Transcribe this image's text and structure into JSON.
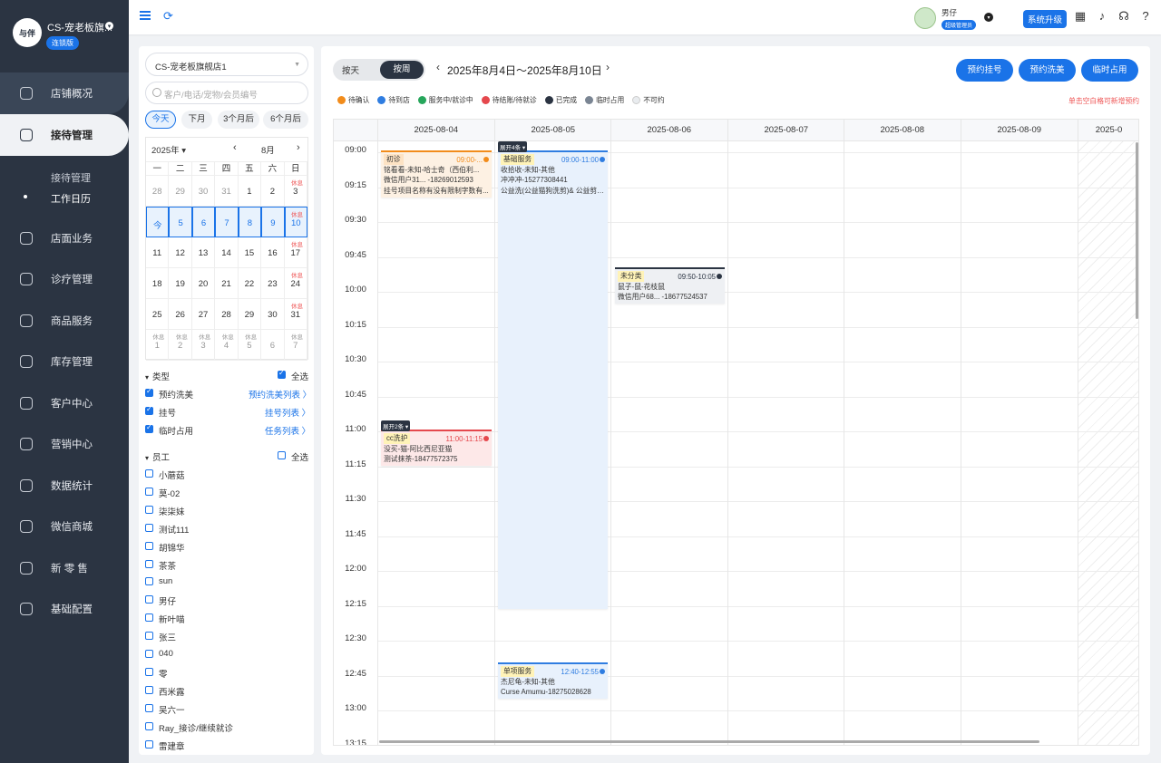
{
  "sidebar": {
    "logo_text": "与伴",
    "store_name": "CS-宠老板旗...",
    "chain_badge": "连锁版",
    "items": [
      {
        "label": "店铺概况",
        "icon": "store-overview-icon"
      },
      {
        "label": "接待管理",
        "icon": "reception-icon"
      },
      {
        "label": "店面业务",
        "icon": "shop-business-icon"
      },
      {
        "label": "诊疗管理",
        "icon": "clinic-icon"
      },
      {
        "label": "商品服务",
        "icon": "goods-icon"
      },
      {
        "label": "库存管理",
        "icon": "inventory-icon"
      },
      {
        "label": "客户中心",
        "icon": "customer-icon"
      },
      {
        "label": "营销中心",
        "icon": "marketing-icon"
      },
      {
        "label": "数据统计",
        "icon": "stats-icon"
      },
      {
        "label": "微信商城",
        "icon": "wechat-mall-icon"
      },
      {
        "label": "新 零 售",
        "icon": "retail-icon"
      },
      {
        "label": "基础配置",
        "icon": "config-icon"
      }
    ],
    "sub_items": [
      "接待管理",
      "工作日历"
    ]
  },
  "topbar": {
    "user_name": "男仔",
    "user_role": "超级管理员",
    "upgrade_label": "系统升级"
  },
  "left": {
    "store_select": "CS-宠老板旗舰店1",
    "search_placeholder": "客户/电话/宠物/会员编号",
    "quick": [
      "今天",
      "下月",
      "3个月后",
      "6个月后"
    ],
    "cal_year": "2025年 ▾",
    "cal_month": "8月",
    "dow": [
      "一",
      "二",
      "三",
      "四",
      "五",
      "六",
      "日"
    ],
    "rest_label": "休息",
    "days": [
      {
        "d": "28",
        "dim": true
      },
      {
        "d": "29",
        "dim": true
      },
      {
        "d": "30",
        "dim": true
      },
      {
        "d": "31",
        "dim": true
      },
      {
        "d": "1"
      },
      {
        "d": "2"
      },
      {
        "d": "3",
        "rest": true
      },
      {
        "d": "今",
        "sel": true
      },
      {
        "d": "5",
        "sel": true
      },
      {
        "d": "6",
        "sel": true
      },
      {
        "d": "7",
        "sel": true
      },
      {
        "d": "8",
        "sel": true
      },
      {
        "d": "9",
        "sel": true
      },
      {
        "d": "10",
        "sel": true,
        "rest": true
      },
      {
        "d": "11"
      },
      {
        "d": "12"
      },
      {
        "d": "13"
      },
      {
        "d": "14"
      },
      {
        "d": "15"
      },
      {
        "d": "16"
      },
      {
        "d": "17",
        "rest": true
      },
      {
        "d": "18"
      },
      {
        "d": "19"
      },
      {
        "d": "20"
      },
      {
        "d": "21"
      },
      {
        "d": "22"
      },
      {
        "d": "23"
      },
      {
        "d": "24",
        "rest": true
      },
      {
        "d": "25"
      },
      {
        "d": "26"
      },
      {
        "d": "27"
      },
      {
        "d": "28"
      },
      {
        "d": "29"
      },
      {
        "d": "30"
      },
      {
        "d": "31",
        "rest": true
      },
      {
        "d": "1",
        "dim": true,
        "rest": true
      },
      {
        "d": "2",
        "dim": true,
        "rest": true
      },
      {
        "d": "3",
        "dim": true,
        "rest": true
      },
      {
        "d": "4",
        "dim": true,
        "rest": true
      },
      {
        "d": "5",
        "dim": true,
        "rest": true
      },
      {
        "d": "6",
        "dim": true
      },
      {
        "d": "7",
        "dim": true,
        "rest": true
      }
    ],
    "type_header": "类型",
    "select_all": "全选",
    "types": [
      {
        "label": "预约洗美",
        "link": "预约洗美列表 〉"
      },
      {
        "label": "挂号",
        "link": "挂号列表 〉"
      },
      {
        "label": "临时占用",
        "link": "任务列表 〉"
      }
    ],
    "staff_header": "员工",
    "staff": [
      "小蘑菇",
      "莫-02",
      "柒柒妹",
      "测试111",
      "胡锦华",
      "茶茶",
      "sun",
      "男仔",
      "新叶喵",
      "张三",
      "040",
      "零",
      "西米露",
      "吴六一",
      "Ray_接诊/继续就诊",
      "雷建章"
    ]
  },
  "main": {
    "view_day": "按天",
    "view_week": "按周",
    "week_range": "2025年8月4日～2025年8月10日",
    "buttons": [
      "预约挂号",
      "预约洗美",
      "临时占用"
    ],
    "legend": [
      {
        "label": "待确认",
        "color": "#f28c1b"
      },
      {
        "label": "待到店",
        "color": "#2f7de1"
      },
      {
        "label": "服务中/就诊中",
        "color": "#26a65b"
      },
      {
        "label": "待结账/待就诊",
        "color": "#e5484d"
      },
      {
        "label": "已完成",
        "color": "#2b3442"
      },
      {
        "label": "临时占用",
        "color": "#7a8593"
      },
      {
        "label": "不可约",
        "color": "#e9ecef"
      }
    ],
    "hint": "单击空白格可新增预约",
    "dates": [
      "2025-08-04",
      "2025-08-05",
      "2025-08-06",
      "2025-08-07",
      "2025-08-08",
      "2025-08-09",
      "2025-0"
    ],
    "times": [
      "09:00",
      "09:15",
      "09:30",
      "09:45",
      "10:00",
      "10:15",
      "10:30",
      "10:45",
      "11:00",
      "11:15",
      "11:30",
      "11:45",
      "12:00",
      "12:15",
      "12:30",
      "12:45",
      "13:00",
      "13:15"
    ],
    "events": [
      {
        "tag": "初诊",
        "time": "09:00-...",
        "l1": "铭看看-未知-哈士奇（西伯利...",
        "l2": "微信用户31...  -18269012593",
        "l3": "挂号项目名称有没有限制字数有...",
        "color": "#f28c1b",
        "bg": "#fdf1e3",
        "tagbg": "#fde3c4"
      },
      {
        "tag": "基础服务",
        "time": "09:00-11:00",
        "l1": "收拾收-未知-其他",
        "l2": "冲冲冲-15277308441",
        "l3": "公益洗(公益猫狗洗剪)& 公益剪(...",
        "color": "#2f7de1",
        "bg": "#e8f1fc",
        "tagbg": "#fff3b8"
      },
      {
        "tag": "未分类",
        "time": "09:50-10:05",
        "l1": "鼠子-鼠-花枝鼠",
        "l2": "微信用户68...  -18677524537",
        "l3": "",
        "color": "#2b3442",
        "bg": "#eef0f3",
        "tagbg": "#fff3b8"
      },
      {
        "tag": "cc洗护",
        "time": "11:00-11:15",
        "l1": "没买-猫-阿比西尼亚猫",
        "l2": "测试抹茶-18477572375",
        "l3": "",
        "color": "#e5484d",
        "bg": "#fde8e8",
        "tagbg": "#fff3b8"
      },
      {
        "tag": "单项服务",
        "time": "12:40-12:55",
        "l1": "杰尼龟-未知-其他",
        "l2": "Curse Amumu-18275028628",
        "l3": "",
        "color": "#2f7de1",
        "bg": "#e8f1fc",
        "tagbg": "#fff3b8"
      }
    ],
    "expand_labels": [
      "展开4条",
      "展开2条"
    ]
  }
}
